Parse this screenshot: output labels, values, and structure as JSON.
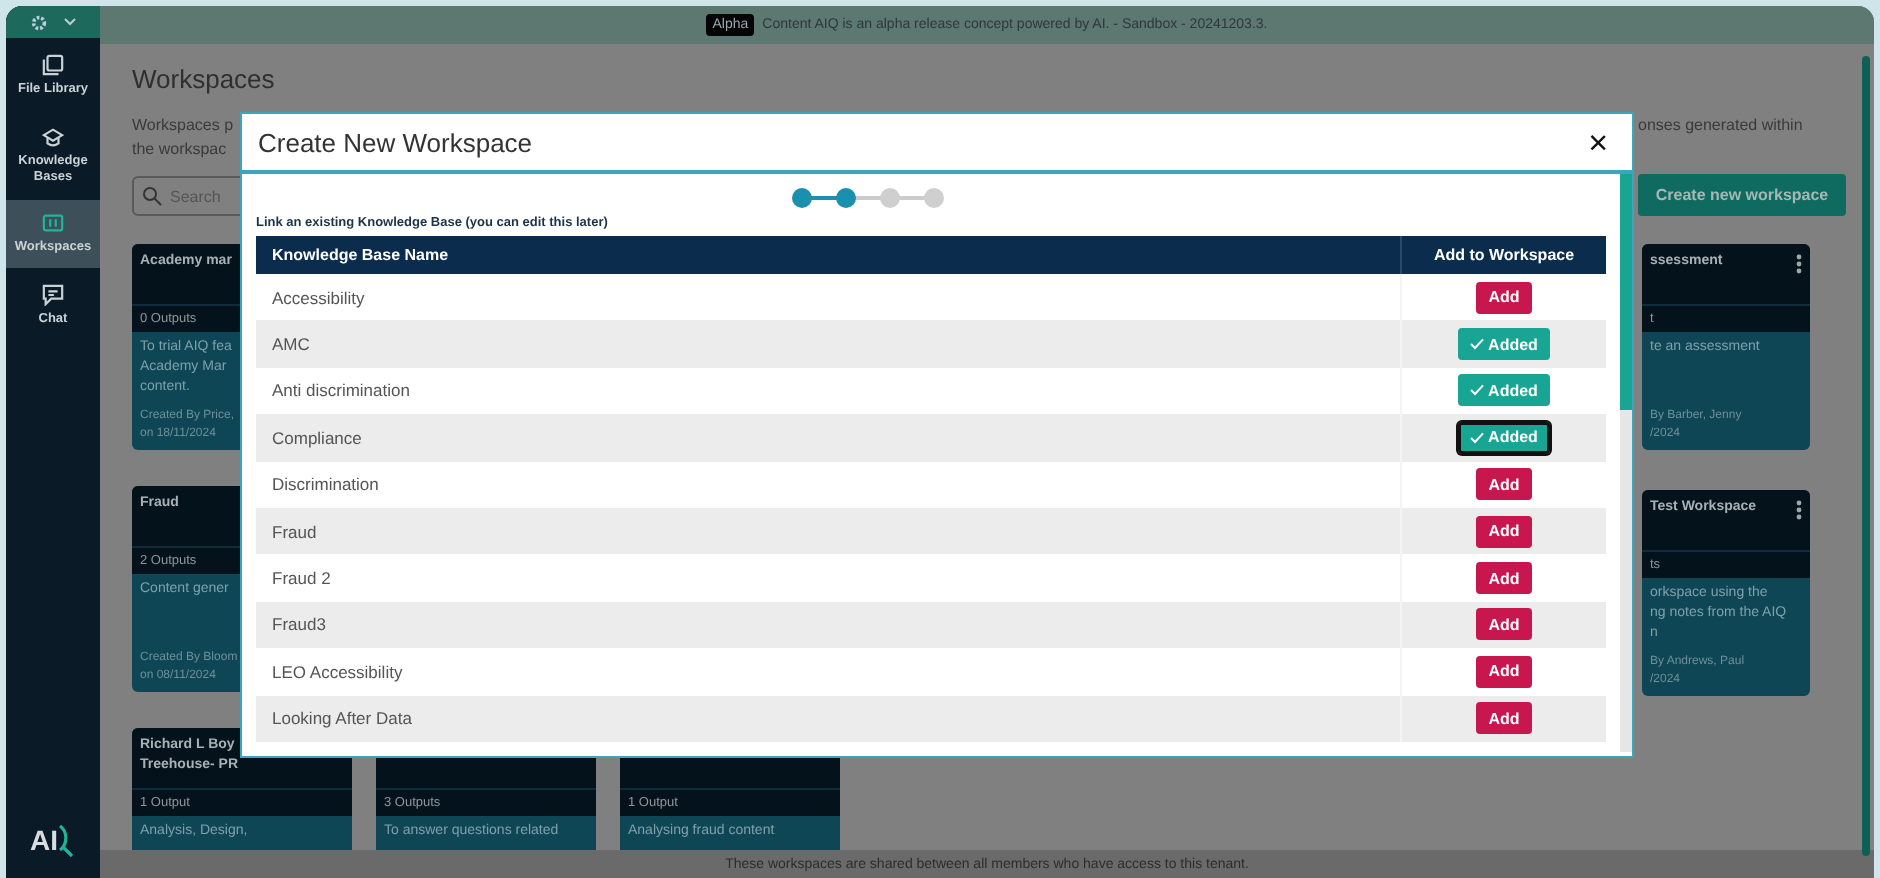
{
  "banner": {
    "badge": "Alpha",
    "text": "Content AIQ is an alpha release concept powered by AI. - Sandbox - 20241203.3."
  },
  "sidebar": {
    "logo": "AI",
    "items": [
      {
        "label": "File Library",
        "selected": false
      },
      {
        "label": "Knowledge Bases",
        "selected": false
      },
      {
        "label": "Workspaces",
        "selected": true
      },
      {
        "label": "Chat",
        "selected": false
      }
    ]
  },
  "page": {
    "title": "Workspaces",
    "description_left": [
      "Workspaces p",
      "the workspac"
    ],
    "description_right": "onses generated within",
    "search": {
      "placeholder": "Search"
    },
    "create_button": "Create new workspace",
    "card_rows": [
      {
        "cards": [
          {
            "title": [
              "Academy mar"
            ],
            "outputs": "0 Outputs",
            "description": [
              "To trial AIQ fea",
              "Academy Mar",
              "content."
            ],
            "created": [
              "Created By Price,",
              "on 18/11/2024"
            ]
          }
        ]
      },
      {
        "cards": [
          {
            "title": [
              "Fraud"
            ],
            "outputs": "2 Outputs",
            "description": [
              "Content gener"
            ],
            "created": [
              "Created By Bloom",
              "on 08/11/2024"
            ]
          }
        ]
      },
      {
        "cards": [
          {
            "title": [
              "Richard L Boy",
              "Treehouse- PR"
            ],
            "outputs": "1 Output",
            "description": [
              "Analysis, Design,"
            ]
          },
          {
            "outputs": "3 Outputs",
            "description": [
              "To answer questions related"
            ]
          },
          {
            "outputs": "1 Output",
            "description": [
              "Analysing fraud content"
            ]
          }
        ]
      }
    ],
    "right_cards": [
      {
        "title": [
          "ssessment"
        ],
        "outputs": "t",
        "description": [
          "te an assessment"
        ],
        "created": [
          "By Barber, Jenny",
          "/2024"
        ],
        "menu": true
      },
      {
        "title": [
          "Test Workspace"
        ],
        "outputs": "ts",
        "description": [
          "orkspace using the",
          "ng notes from the AIQ",
          "n"
        ],
        "created": [
          "By Andrews, Paul",
          "/2024"
        ],
        "menu": true
      }
    ],
    "footer": "These workspaces are shared between all members who have access to this tenant."
  },
  "modal": {
    "title": "Create New Workspace",
    "close": "×",
    "steps": [
      {
        "done": true
      },
      {
        "done": true
      },
      {
        "done": false
      },
      {
        "done": false
      }
    ],
    "subtitle": "Link an existing Knowledge Base (you can edit this later)",
    "columns": [
      "Knowledge Base Name",
      "Add to Workspace"
    ],
    "rows": [
      {
        "name": "Accessibility",
        "added": false,
        "focused": false,
        "action": "Add"
      },
      {
        "name": "AMC",
        "added": true,
        "focused": false,
        "action": "Added"
      },
      {
        "name": "Anti discrimination",
        "added": true,
        "focused": false,
        "action": "Added"
      },
      {
        "name": "Compliance",
        "added": true,
        "focused": true,
        "action": "Added"
      },
      {
        "name": "Discrimination",
        "added": false,
        "focused": false,
        "action": "Add"
      },
      {
        "name": "Fraud",
        "added": false,
        "focused": false,
        "action": "Add"
      },
      {
        "name": "Fraud 2",
        "added": false,
        "focused": false,
        "action": "Add"
      },
      {
        "name": "Fraud3",
        "added": false,
        "focused": false,
        "action": "Add"
      },
      {
        "name": "LEO Accessibility",
        "added": false,
        "focused": false,
        "action": "Add"
      },
      {
        "name": "Looking After Data",
        "added": false,
        "focused": false,
        "action": "Add"
      }
    ]
  }
}
